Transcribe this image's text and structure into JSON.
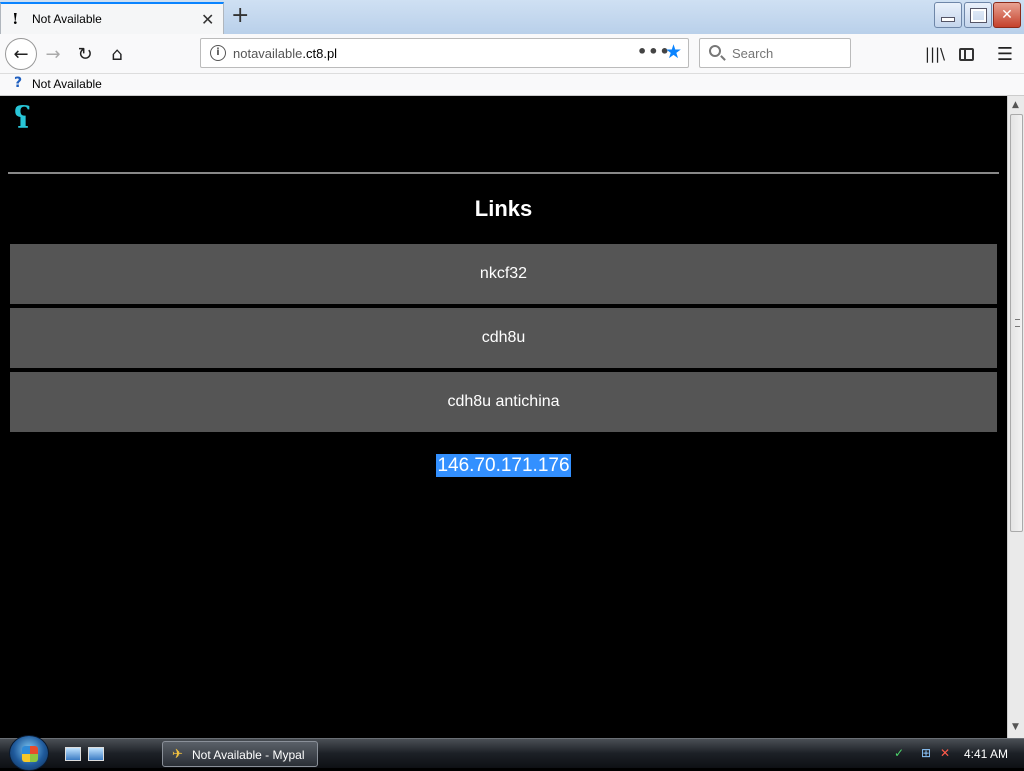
{
  "browser": {
    "tab_title": "Not Available",
    "url_host_prefix": "notavailable",
    "url_host_domain": ".ct8.pl",
    "search_placeholder": "Search",
    "bookmark_label": "Not Available"
  },
  "page": {
    "heading": "Links",
    "links": [
      "nkcf32",
      "cdh8u",
      "cdh8u antichina"
    ],
    "ip_address": "146.70.171.176"
  },
  "taskbar": {
    "window_label": "Not Available - Mypal",
    "clock": "4:41 AM"
  },
  "colors": {
    "accent": "#0a84ff",
    "link_button_bg": "#555555",
    "selection": "#3390ff",
    "logo": "#28c6d8"
  }
}
